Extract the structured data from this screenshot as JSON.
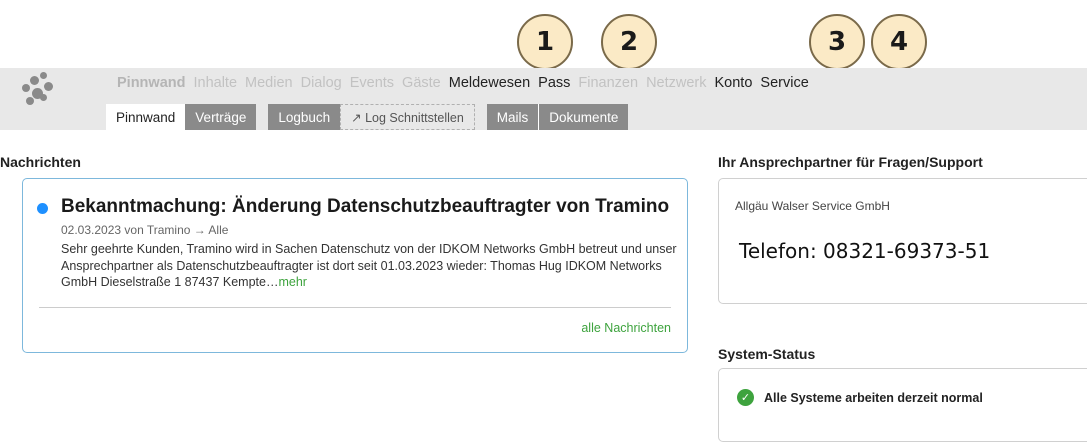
{
  "callouts": [
    "1",
    "2",
    "3",
    "4"
  ],
  "main_nav": [
    {
      "label": "Pinnwand"
    },
    {
      "label": "Inhalte"
    },
    {
      "label": "Medien"
    },
    {
      "label": "Dialog"
    },
    {
      "label": "Events"
    },
    {
      "label": "Gäste"
    },
    {
      "label": "Meldewesen"
    },
    {
      "label": "Pass"
    },
    {
      "label": "Finanzen"
    },
    {
      "label": "Netzwerk"
    },
    {
      "label": "Konto"
    },
    {
      "label": "Service"
    }
  ],
  "sub_nav": [
    {
      "label": "Pinnwand"
    },
    {
      "label": "Verträge"
    },
    {
      "label": "Logbuch"
    },
    {
      "label": "↗ Log Schnittstellen"
    },
    {
      "label": "Mails"
    },
    {
      "label": "Dokumente"
    }
  ],
  "news": {
    "section_title": "Nachrichten",
    "title": "Bekanntmachung: Änderung Datenschutzbeauftragter von Tramino",
    "meta": "02.03.2023 von Tramino → Alle",
    "body": "Sehr geehrte Kunden, Tramino wird in Sachen Datenschutz von der IDKOM Networks GmbH betreut und unser Ansprechpartner als Datenschutzbeauftragter ist dort seit 01.03.2023 wieder: Thomas Hug IDKOM Networks GmbH Dieselstraße 1 87437 Kempte…",
    "more": "mehr",
    "all_link": "alle Nachrichten"
  },
  "contact": {
    "section_title": "Ihr Ansprechpartner für Fragen/Support",
    "company": "Allgäu Walser Service GmbH",
    "phone": "Telefon: 08321-69373-51"
  },
  "status": {
    "section_title": "System-Status",
    "text": "Alle Systeme arbeiten derzeit normal"
  },
  "colors": {
    "accent_blue": "#1e90ff",
    "link_green": "#3ea33e",
    "card_border": "#7db8dc",
    "topbar": "#e8e8e8",
    "tab_dark": "#8a8a8a",
    "callout_fill": "#fbeac6"
  },
  "icons": {
    "logo": "tramino-logo-icon",
    "status_ok": "check-circle-icon",
    "news_unread": "unread-dot-icon"
  }
}
